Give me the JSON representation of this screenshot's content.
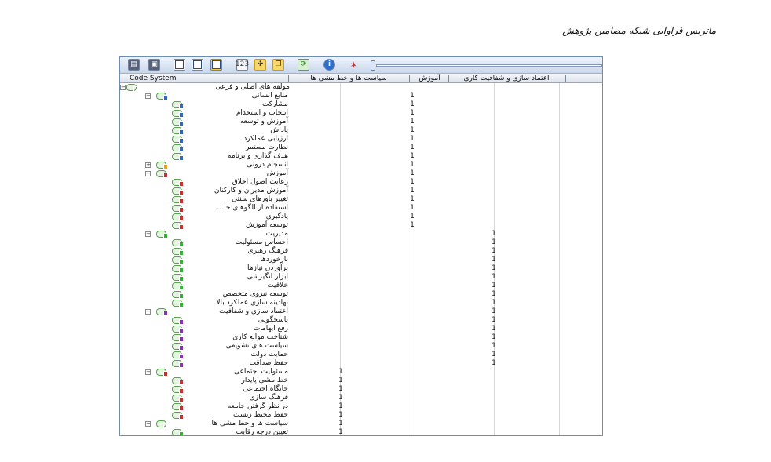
{
  "caption": "ماتریس فراوانی شبکه مضامین پژوهش",
  "header": {
    "code_system": "Code System",
    "columns": [
      "سیاست ها و خط مشی ها",
      "آموزش",
      "اعتماد سازی و شفافیت کاری"
    ]
  },
  "colors": {
    "green": "#2fb52f",
    "blue": "#2e66c9",
    "red": "#d62b2b",
    "purple": "#8a2fb8",
    "orange": "#f0a020"
  },
  "rows": [
    {
      "label": "مولفه های اصلی و فرعی",
      "level": 0,
      "toggle": "minus",
      "color": null,
      "values": [
        "",
        "",
        ""
      ]
    },
    {
      "label": "منابع انسانی",
      "level": 1,
      "toggle": "minus",
      "color": "blue",
      "values": [
        "",
        "1",
        ""
      ]
    },
    {
      "label": "مشارکت",
      "level": 2,
      "toggle": null,
      "color": "blue",
      "values": [
        "",
        "1",
        ""
      ]
    },
    {
      "label": "انتخاب و استخدام",
      "level": 2,
      "toggle": null,
      "color": "blue",
      "values": [
        "",
        "1",
        ""
      ]
    },
    {
      "label": "آموزش و توسعه",
      "level": 2,
      "toggle": null,
      "color": "blue",
      "values": [
        "",
        "1",
        ""
      ]
    },
    {
      "label": "پاداش",
      "level": 2,
      "toggle": null,
      "color": "blue",
      "values": [
        "",
        "1",
        ""
      ]
    },
    {
      "label": "ارزیابی عملکرد",
      "level": 2,
      "toggle": null,
      "color": "blue",
      "values": [
        "",
        "1",
        ""
      ]
    },
    {
      "label": "نظارت مستمر",
      "level": 2,
      "toggle": null,
      "color": "blue",
      "values": [
        "",
        "1",
        ""
      ]
    },
    {
      "label": "هدف گذاری و برنامه",
      "level": 2,
      "toggle": null,
      "color": "blue",
      "values": [
        "",
        "1",
        ""
      ]
    },
    {
      "label": "انسجام درونی",
      "level": 1,
      "toggle": "plus",
      "color": "orange",
      "values": [
        "",
        "1",
        ""
      ]
    },
    {
      "label": "آموزش",
      "level": 1,
      "toggle": "minus",
      "color": "red",
      "values": [
        "",
        "1",
        ""
      ]
    },
    {
      "label": "رعایت اصول اخلاق",
      "level": 2,
      "toggle": null,
      "color": "red",
      "values": [
        "",
        "1",
        ""
      ]
    },
    {
      "label": "آموزش مدیران و کارکنان",
      "level": 2,
      "toggle": null,
      "color": "red",
      "values": [
        "",
        "1",
        ""
      ]
    },
    {
      "label": "تغییر باورهای سنتی",
      "level": 2,
      "toggle": null,
      "color": "red",
      "values": [
        "",
        "1",
        ""
      ]
    },
    {
      "label": "استفاده از الگوهای خا...",
      "level": 2,
      "toggle": null,
      "color": "red",
      "values": [
        "",
        "1",
        ""
      ]
    },
    {
      "label": "یادگیری",
      "level": 2,
      "toggle": null,
      "color": "red",
      "values": [
        "",
        "1",
        ""
      ]
    },
    {
      "label": "توسعه آموزش",
      "level": 2,
      "toggle": null,
      "color": "red",
      "values": [
        "",
        "1",
        ""
      ]
    },
    {
      "label": "مدیریت",
      "level": 1,
      "toggle": "minus",
      "color": "green",
      "values": [
        "",
        "",
        "1"
      ]
    },
    {
      "label": "احساس مسئولیت",
      "level": 2,
      "toggle": null,
      "color": "green",
      "values": [
        "",
        "",
        "1"
      ]
    },
    {
      "label": "فرهنگ رهبری",
      "level": 2,
      "toggle": null,
      "color": "green",
      "values": [
        "",
        "",
        "1"
      ]
    },
    {
      "label": "بازخوردها",
      "level": 2,
      "toggle": null,
      "color": "green",
      "values": [
        "",
        "",
        "1"
      ]
    },
    {
      "label": "برآوردن نیازها",
      "level": 2,
      "toggle": null,
      "color": "green",
      "values": [
        "",
        "",
        "1"
      ]
    },
    {
      "label": "ابزار انگیزشی",
      "level": 2,
      "toggle": null,
      "color": "green",
      "values": [
        "",
        "",
        "1"
      ]
    },
    {
      "label": "خلاقیت",
      "level": 2,
      "toggle": null,
      "color": "green",
      "values": [
        "",
        "",
        "1"
      ]
    },
    {
      "label": "توسعه نیروی متخصص",
      "level": 2,
      "toggle": null,
      "color": "green",
      "values": [
        "",
        "",
        "1"
      ]
    },
    {
      "label": "نهادینه سازی عملکرد بالا",
      "level": 2,
      "toggle": null,
      "color": "green",
      "values": [
        "",
        "",
        "1"
      ]
    },
    {
      "label": "اعتماد سازی و شفافیت",
      "level": 1,
      "toggle": "minus",
      "color": "purple",
      "values": [
        "",
        "",
        "1"
      ]
    },
    {
      "label": "پاسخگویی",
      "level": 2,
      "toggle": null,
      "color": "purple",
      "values": [
        "",
        "",
        "1"
      ]
    },
    {
      "label": "رفع ابهامات",
      "level": 2,
      "toggle": null,
      "color": "purple",
      "values": [
        "",
        "",
        "1"
      ]
    },
    {
      "label": "شناخت موانع کاری",
      "level": 2,
      "toggle": null,
      "color": "purple",
      "values": [
        "",
        "",
        "1"
      ]
    },
    {
      "label": "سیاست های تشویقی",
      "level": 2,
      "toggle": null,
      "color": "purple",
      "values": [
        "",
        "",
        "1"
      ]
    },
    {
      "label": "حمایت دولت",
      "level": 2,
      "toggle": null,
      "color": "purple",
      "values": [
        "",
        "",
        "1"
      ]
    },
    {
      "label": "حفظ صداقت",
      "level": 2,
      "toggle": null,
      "color": "purple",
      "values": [
        "",
        "",
        "1"
      ]
    },
    {
      "label": "مسئولیت اجتماعی",
      "level": 1,
      "toggle": "minus",
      "color": "red",
      "values": [
        "1",
        "",
        ""
      ]
    },
    {
      "label": "خط مشی پایدار",
      "level": 2,
      "toggle": null,
      "color": "red",
      "values": [
        "1",
        "",
        ""
      ]
    },
    {
      "label": "جایگاه اجتماعی",
      "level": 2,
      "toggle": null,
      "color": "red",
      "values": [
        "1",
        "",
        ""
      ]
    },
    {
      "label": "فرهنگ سازی",
      "level": 2,
      "toggle": null,
      "color": "red",
      "values": [
        "1",
        "",
        ""
      ]
    },
    {
      "label": "در نظر گرفتن جامعه",
      "level": 2,
      "toggle": null,
      "color": "red",
      "values": [
        "1",
        "",
        ""
      ]
    },
    {
      "label": "حفظ محیط زیست",
      "level": 2,
      "toggle": null,
      "color": "red",
      "values": [
        "1",
        "",
        ""
      ]
    },
    {
      "label": "سیاست ها و خط مشی ها",
      "level": 1,
      "toggle": "minus",
      "color": null,
      "values": [
        "1",
        "",
        ""
      ]
    },
    {
      "label": "تعیین درجه رقابت",
      "level": 2,
      "toggle": null,
      "color": "green",
      "values": [
        "1",
        "",
        ""
      ]
    }
  ]
}
